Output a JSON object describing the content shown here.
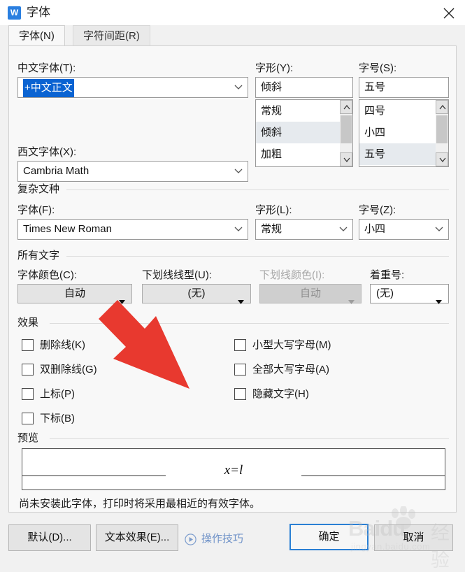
{
  "window": {
    "title": "字体",
    "app_icon": "wps-writer-icon",
    "icon_letter": "W",
    "close_label": "×"
  },
  "tabs": [
    {
      "label": "字体(N)",
      "active": true
    },
    {
      "label": "字符间距(R)",
      "active": false
    }
  ],
  "latin_section": {
    "chinese_font": {
      "label": "中文字体(T):",
      "value": "+中文正文",
      "selected": true
    },
    "western_font": {
      "label": "西文字体(X):",
      "value": "Cambria Math"
    },
    "font_style": {
      "label": "字形(Y):",
      "value": "倾斜",
      "options": [
        "常规",
        "倾斜",
        "加粗"
      ],
      "selected_option": "倾斜"
    },
    "font_size": {
      "label": "字号(S):",
      "value": "五号",
      "options": [
        "四号",
        "小四",
        "五号"
      ],
      "selected_option": "五号"
    }
  },
  "complex_section": {
    "title": "复杂文种",
    "font": {
      "label": "字体(F):",
      "value": "Times New Roman"
    },
    "style": {
      "label": "字形(L):",
      "value": "常规"
    },
    "size": {
      "label": "字号(Z):",
      "value": "小四"
    }
  },
  "all_text_section": {
    "title": "所有文字",
    "font_color": {
      "label": "字体颜色(C):",
      "value": "自动",
      "disabled": false
    },
    "underline_style": {
      "label": "下划线线型(U):",
      "value": "(无)",
      "disabled": false
    },
    "underline_color": {
      "label": "下划线颜色(I):",
      "value": "自动",
      "disabled": true
    },
    "emphasis_mark": {
      "label": "着重号:",
      "value": "(无)",
      "disabled": false
    }
  },
  "effects_section": {
    "title": "效果",
    "left_column": [
      {
        "label": "删除线(K)",
        "checked": false
      },
      {
        "label": "双删除线(G)",
        "checked": false
      },
      {
        "label": "上标(P)",
        "checked": false
      },
      {
        "label": "下标(B)",
        "checked": false
      }
    ],
    "right_column": [
      {
        "label": "小型大写字母(M)",
        "checked": false
      },
      {
        "label": "全部大写字母(A)",
        "checked": false
      },
      {
        "label": "隐藏文字(H)",
        "checked": false
      }
    ]
  },
  "preview_section": {
    "title": "预览",
    "sample_text": "x=l",
    "note": "尚未安装此字体，打印时将采用最相近的有效字体。"
  },
  "footer": {
    "default_button": "默认(D)...",
    "text_effects_button": "文本效果(E)...",
    "tips_link": "操作技巧",
    "tips_icon": "play-circle-icon",
    "ok_button": "确定",
    "cancel_button": "取消"
  },
  "annotation": {
    "type": "red-arrow",
    "color": "#e8392f",
    "points_to": "字体颜色(C) 下拉按钮"
  },
  "watermark": {
    "brand": "Baidu",
    "suffix": "经验",
    "domain": "jingyan.baidu.com"
  },
  "colors": {
    "accent": "#2a7fd4",
    "selection": "#0a63d2",
    "link": "#6f92c8",
    "annotation": "#e8392f",
    "dialog_bg": "#f1f1f1",
    "panel_bg": "#f8f8f8"
  }
}
